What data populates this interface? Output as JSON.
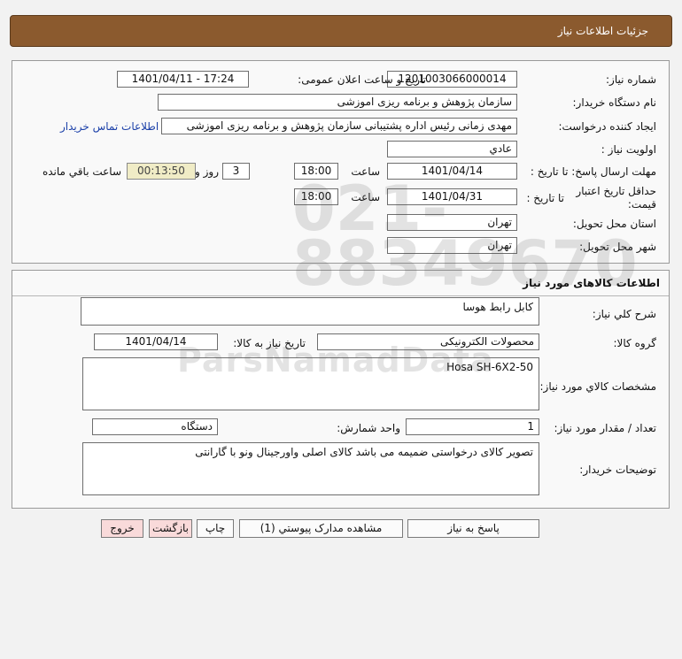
{
  "header": {
    "title": "جزئیات اطلاعات نیاز"
  },
  "need_info": {
    "need_number_label": "شماره نیاز:",
    "need_number": "1201003066000014",
    "announce_label": "تاریخ و ساعت اعلان عمومی:",
    "announce_value": "1401/04/11 - 17:24",
    "buyer_org_label": "نام دستگاه خریدار:",
    "buyer_org": "سازمان پژوهش و برنامه ریزی اموزشی",
    "requester_label": "ایجاد کننده درخواست:",
    "requester": "مهدی زمانی رئیس اداره پشتیبانی سازمان پژوهش و برنامه ریزی اموزشی",
    "contact_link": "اطلاعات تماس خریدار",
    "priority_label": "اولویت نیاز :",
    "priority": "عادي",
    "deadline_label": "مهلت ارسال پاسخ: تا تاریخ :",
    "deadline_date": "1401/04/14",
    "time_label": "ساعت",
    "deadline_time": "18:00",
    "days_value": "3",
    "days_label": "روز و",
    "remaining_time": "00:13:50",
    "remaining_label": "ساعت باقي مانده",
    "validity_label_1": "حداقل تاریخ اعتبار",
    "validity_label_2": "قیمت:",
    "validity_to_label": "تا تاریخ :",
    "validity_date": "1401/04/31",
    "validity_time_label": "ساعت",
    "validity_time": "18:00",
    "province_label": "استان محل تحویل:",
    "province": "تهران",
    "city_label": "شهر محل تحویل:",
    "city": "تهران"
  },
  "goods_info": {
    "section_title": "اطلاعات کالاهای مورد نیاز",
    "general_desc_label": "شرح کلي نیاز:",
    "general_desc": "کابل رابط هوسا",
    "group_label": "گروه کالا:",
    "group": "محصولات الکترونیکی",
    "need_date_label": "تاریخ نیاز به کالا:",
    "need_date": "1401/04/14",
    "specs_label": "مشخصات کالاي مورد نیاز:",
    "specs": "Hosa SH-6X2-50",
    "qty_label": "تعداد / مقدار مورد نیاز:",
    "qty": "1",
    "unit_label": "واحد شمارش:",
    "unit": "دستگاه",
    "buyer_notes_label": "توضیحات خریدار:",
    "buyer_notes": "تصویر کالای درخواستی ضمیمه می باشد کالای اصلی واورجینال ونو با گارانتی"
  },
  "buttons": {
    "reply": "پاسخ به نیاز",
    "attachments": "مشاهده مدارک پیوستي (1)",
    "print": "چاپ",
    "back": "بازگشت",
    "exit": "خروج"
  },
  "watermark": {
    "digits": "021-88349670",
    "brand": "ParsNamadData"
  }
}
